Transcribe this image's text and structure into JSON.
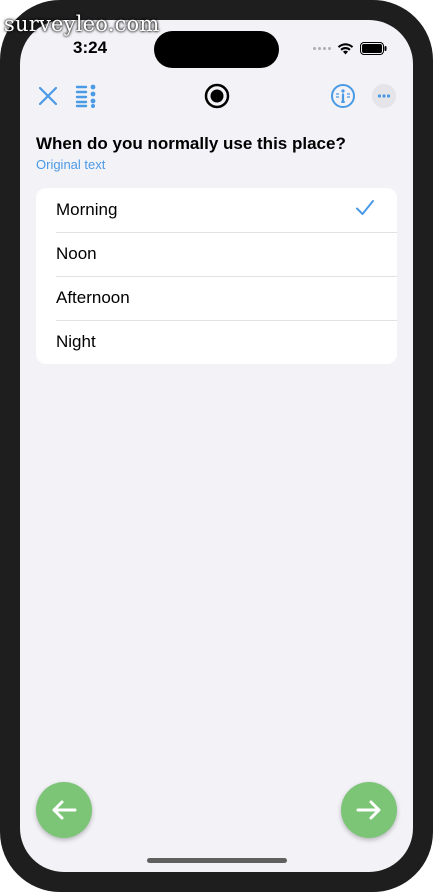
{
  "watermark": "surveyleo.com",
  "status_bar": {
    "time": "3:24"
  },
  "toolbar": {
    "close_icon": "close-icon",
    "list_icon": "list-icon",
    "record_icon": "record-icon",
    "info_icon": "info-icon",
    "more_icon": "more-icon"
  },
  "question": {
    "text": "When do you normally use this place?",
    "original_text_link": "Original text"
  },
  "options": [
    {
      "label": "Morning",
      "selected": true
    },
    {
      "label": "Noon",
      "selected": false
    },
    {
      "label": "Afternoon",
      "selected": false
    },
    {
      "label": "Night",
      "selected": false
    }
  ],
  "navigation": {
    "back_icon": "arrow-left-icon",
    "next_icon": "arrow-right-icon"
  },
  "colors": {
    "accent": "#4a9ae6",
    "fab": "#7cc577",
    "background": "#f2f2f7"
  }
}
